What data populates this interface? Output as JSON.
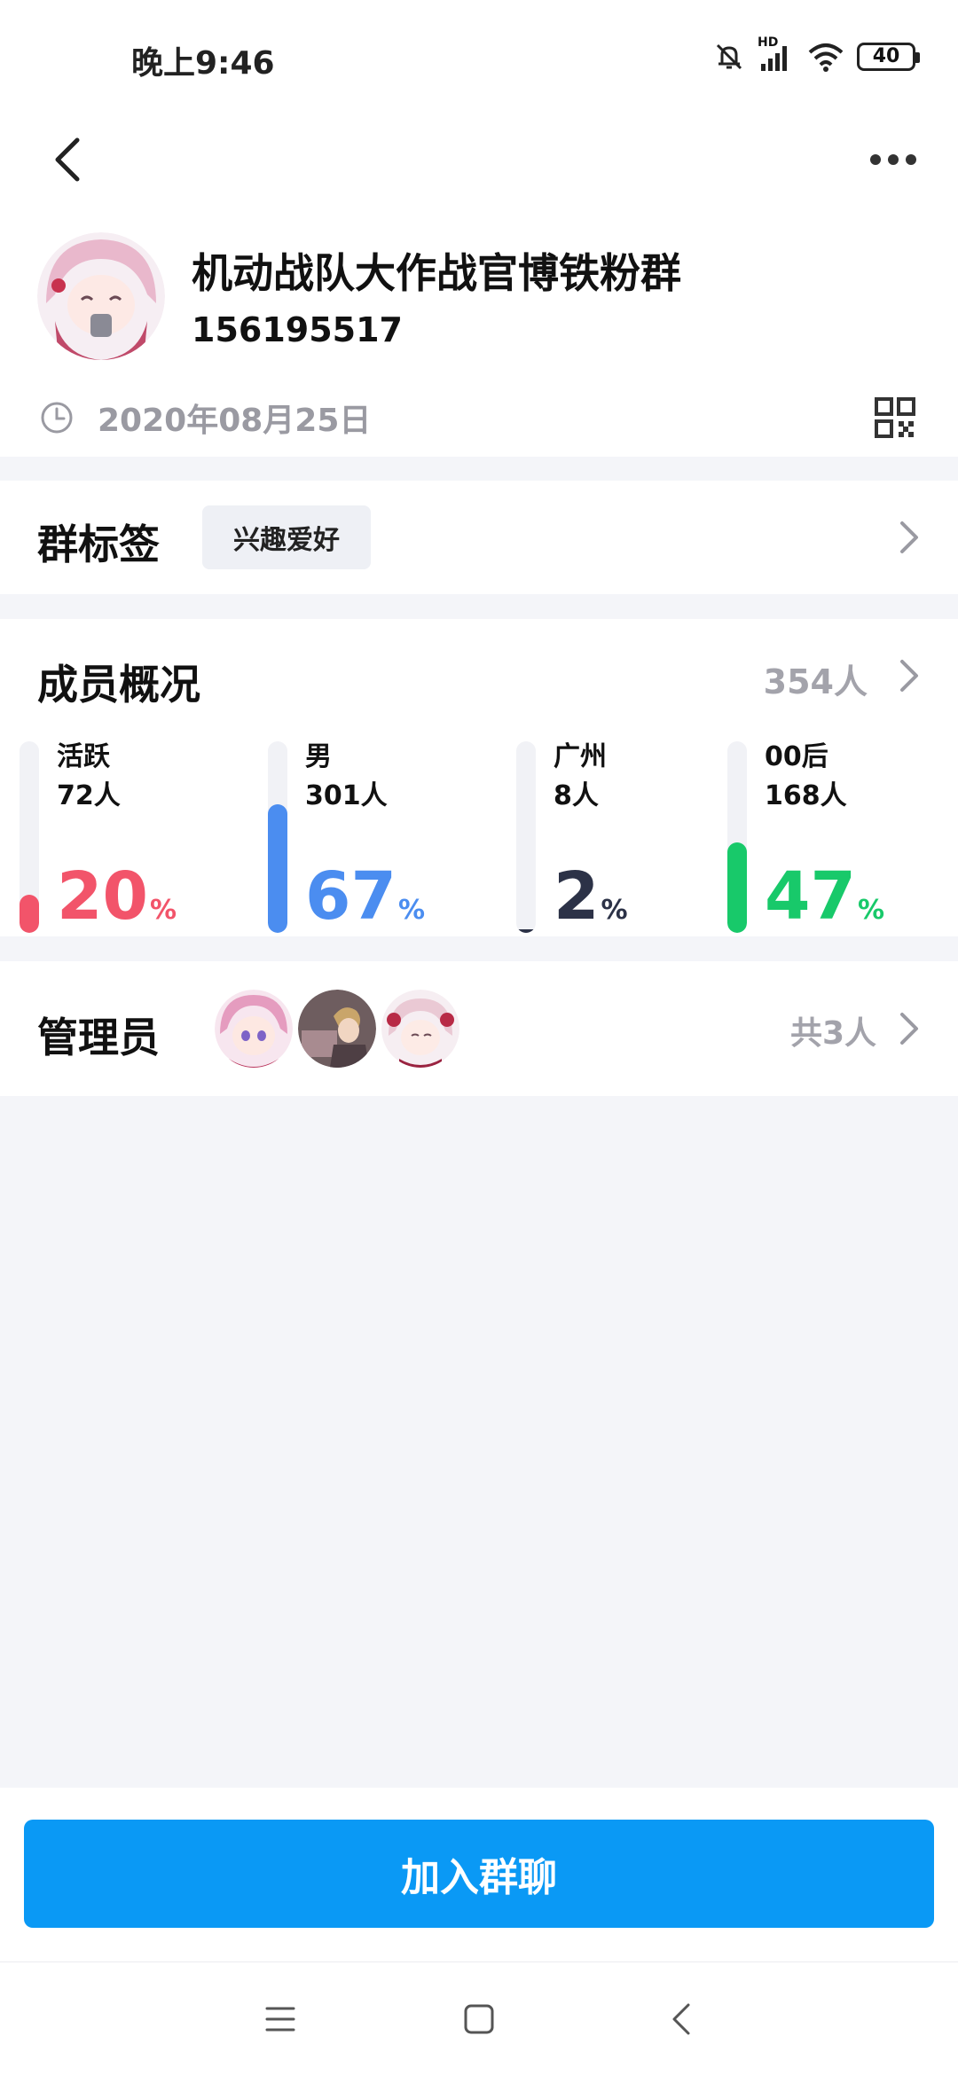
{
  "status_bar": {
    "time": "晚上9:46",
    "network_label": "HD",
    "battery": "40"
  },
  "group": {
    "name": "机动战队大作战官博铁粉群",
    "id": "156195517",
    "created_date": "2020年08月25日"
  },
  "tags": {
    "title": "群标签",
    "chip": "兴趣爱好"
  },
  "members": {
    "title": "成员概况",
    "total": "354人",
    "stats": [
      {
        "label": "活跃",
        "count": "72人",
        "percent": "20",
        "fill": 0.2,
        "color": "#f2546a"
      },
      {
        "label": "男",
        "count": "301人",
        "percent": "67",
        "fill": 0.67,
        "color": "#4b8df0"
      },
      {
        "label": "广州",
        "count": "8人",
        "percent": "2",
        "fill": 0.02,
        "color": "#2c3247"
      },
      {
        "label": "00后",
        "count": "168人",
        "percent": "47",
        "fill": 0.47,
        "color": "#18c96a"
      }
    ],
    "percent_unit": "%"
  },
  "admins": {
    "title": "管理员",
    "total": "共3人"
  },
  "actions": {
    "join": "加入群聊"
  },
  "icons": {
    "back": "back-arrow-icon",
    "more": "more-dots-icon",
    "clock": "clock-icon",
    "qr": "qr-code-icon",
    "chevron": "chevron-right-icon"
  }
}
